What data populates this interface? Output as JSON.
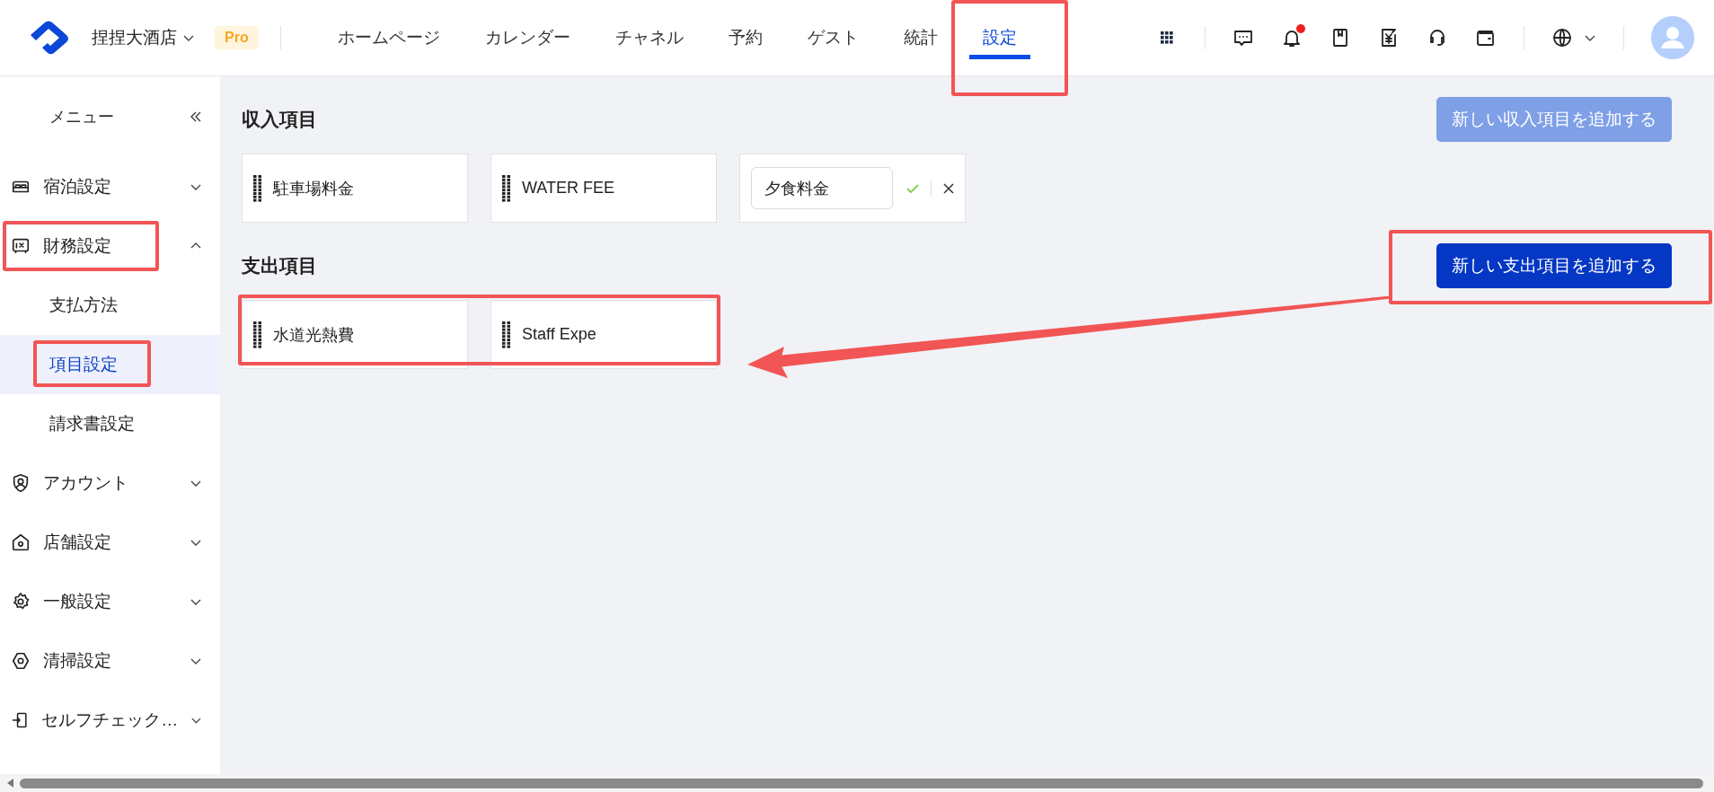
{
  "header": {
    "hotel_name": "捏捏大酒店",
    "plan_badge": "Pro",
    "notification_dot": true,
    "nav": [
      {
        "label": "ホームページ",
        "selected": false,
        "highlighted": false
      },
      {
        "label": "カレンダー",
        "selected": false,
        "highlighted": false
      },
      {
        "label": "チャネル",
        "selected": false,
        "highlighted": false
      },
      {
        "label": "予約",
        "selected": false,
        "highlighted": false
      },
      {
        "label": "ゲスト",
        "selected": false,
        "highlighted": false
      },
      {
        "label": "統計",
        "selected": false,
        "highlighted": false
      },
      {
        "label": "設定",
        "selected": true,
        "highlighted": true
      }
    ]
  },
  "sidebar": {
    "title": "メニュー",
    "items": [
      {
        "label": "宿泊設定",
        "expanded": false,
        "highlighted": false
      },
      {
        "label": "財務設定",
        "expanded": true,
        "highlighted": true,
        "children": [
          {
            "label": "支払方法",
            "selected": false,
            "highlighted": false
          },
          {
            "label": "項目設定",
            "selected": true,
            "highlighted": true
          },
          {
            "label": "請求書設定",
            "selected": false,
            "highlighted": false
          }
        ]
      },
      {
        "label": "アカウント",
        "expanded": false,
        "highlighted": false
      },
      {
        "label": "店舗設定",
        "expanded": false,
        "highlighted": false
      },
      {
        "label": "一般設定",
        "expanded": false,
        "highlighted": false
      },
      {
        "label": "清掃設定",
        "expanded": false,
        "highlighted": false
      },
      {
        "label": "セルフチェック…",
        "expanded": false,
        "highlighted": false
      }
    ]
  },
  "income": {
    "title": "収入項目",
    "add_button": {
      "label": "新しい収入項目を追加する",
      "disabled": true
    },
    "items": [
      {
        "kind": "item",
        "label": "駐車場料金"
      },
      {
        "kind": "item",
        "label": "WATER FEE"
      },
      {
        "kind": "editing",
        "value": "夕食料金"
      }
    ]
  },
  "expense": {
    "title": "支出項目",
    "add_button": {
      "label": "新しい支出項目を追加する",
      "disabled": false,
      "highlighted": true
    },
    "items_highlighted": true,
    "callout_arrow": true,
    "items": [
      {
        "kind": "item",
        "label": "水道光熱費"
      },
      {
        "kind": "item",
        "label": "Staff Expe"
      }
    ]
  }
}
